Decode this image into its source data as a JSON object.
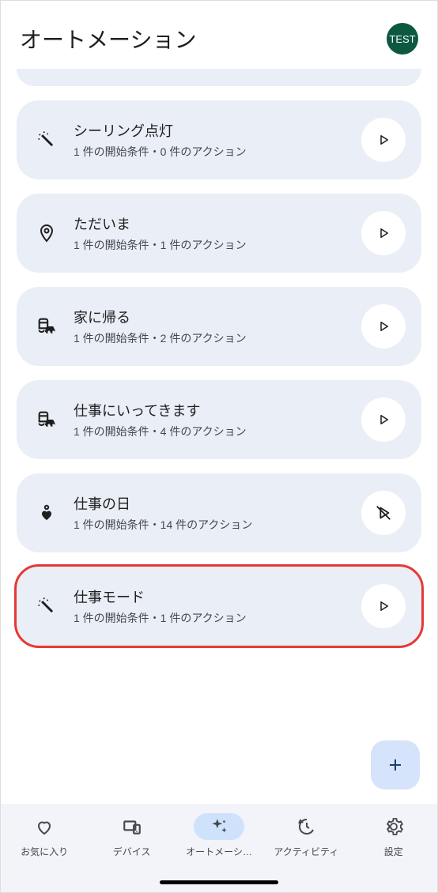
{
  "header": {
    "title": "オートメーション",
    "avatar_label": "TEST"
  },
  "automations": [
    {
      "title": "シーリング点灯",
      "subtitle": "1 件の開始条件・0 件のアクション",
      "icon": "wand",
      "play": "play",
      "highlighted": false
    },
    {
      "title": "ただいま",
      "subtitle": "1 件の開始条件・1 件のアクション",
      "icon": "pin",
      "play": "play",
      "highlighted": false
    },
    {
      "title": "家に帰る",
      "subtitle": "1 件の開始条件・2 件のアクション",
      "icon": "commute",
      "play": "play",
      "highlighted": false
    },
    {
      "title": "仕事にいってきます",
      "subtitle": "1 件の開始条件・4 件のアクション",
      "icon": "commute",
      "play": "play",
      "highlighted": false
    },
    {
      "title": "仕事の日",
      "subtitle": "1 件の開始条件・14 件のアクション",
      "icon": "heart",
      "play": "play-off",
      "highlighted": false
    },
    {
      "title": "仕事モード",
      "subtitle": "1 件の開始条件・1 件のアクション",
      "icon": "wand",
      "play": "play",
      "highlighted": true
    }
  ],
  "nav": {
    "items": [
      {
        "label": "お気に入り",
        "icon": "heart-outline",
        "active": false
      },
      {
        "label": "デバイス",
        "icon": "devices",
        "active": false
      },
      {
        "label": "オートメーシ…",
        "icon": "sparkle",
        "active": true
      },
      {
        "label": "アクティビティ",
        "icon": "history",
        "active": false
      },
      {
        "label": "設定",
        "icon": "gear",
        "active": false
      }
    ]
  }
}
